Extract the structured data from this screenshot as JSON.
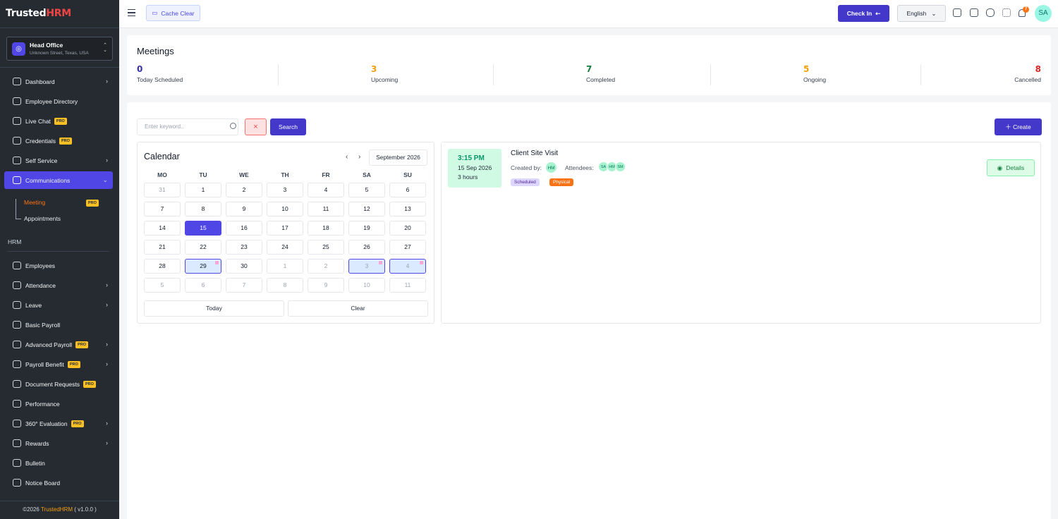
{
  "sidebar": {
    "logo_prefix": "Trusted",
    "logo_suffix": "HRM",
    "office": {
      "name": "Head Office",
      "address": "Unknown Street, Texas, USA"
    },
    "items": [
      {
        "label": "Dashboard",
        "icon": "dashboard-icon"
      },
      {
        "label": "Employee Directory",
        "icon": "directory-icon"
      },
      {
        "label": "Live Chat",
        "icon": "chat-icon",
        "badge": "PRO"
      },
      {
        "label": "Credentials",
        "icon": "key-icon",
        "badge": "PRO"
      },
      {
        "label": "Self Service",
        "icon": "self-service-icon"
      },
      {
        "label": "Communications",
        "icon": "users-icon"
      }
    ],
    "sub_items": [
      {
        "label": "Meeting",
        "badge": "PRO"
      },
      {
        "label": "Appointments"
      }
    ],
    "section": "HRM",
    "hrm_items": [
      {
        "label": "Employees"
      },
      {
        "label": "Attendance"
      },
      {
        "label": "Leave"
      },
      {
        "label": "Basic Payroll"
      },
      {
        "label": "Advanced Payroll",
        "badge": "PRO"
      },
      {
        "label": "Payroll Benefit",
        "badge": "PRO"
      },
      {
        "label": "Document Requests",
        "badge": "PRO"
      },
      {
        "label": "Performance"
      },
      {
        "label": "360° Evaluation",
        "badge": "PRO"
      },
      {
        "label": "Rewards"
      },
      {
        "label": "Bulletin"
      },
      {
        "label": "Notice Board"
      }
    ],
    "footer_prefix": "©2026 ",
    "footer_brand": "TrustedHRM",
    "footer_version": " ( v1.0.0 )"
  },
  "topbar": {
    "cache_label": "Cache Clear",
    "checkin_label": "Check In",
    "language": "English",
    "notification_count": "7",
    "avatar_initials": "SA",
    "icons": [
      "add-icon",
      "task-icon",
      "message-icon",
      "apps-icon",
      "bell-icon"
    ]
  },
  "stats": {
    "title": "Meetings",
    "items": [
      {
        "value": "0",
        "label": "Today Scheduled",
        "color": "#3730a3"
      },
      {
        "value": "3",
        "label": "Upcoming",
        "color": "#f59e0b"
      },
      {
        "value": "7",
        "label": "Completed",
        "color": "#15803d"
      },
      {
        "value": "5",
        "label": "Ongoing",
        "color": "#f59e0b"
      },
      {
        "value": "8",
        "label": "Cancelled",
        "color": "#dc2626"
      }
    ]
  },
  "filter": {
    "placeholder": "Enter keyword..",
    "clear_symbol": "×",
    "search_label": "Search",
    "create_label": "Create"
  },
  "calendar": {
    "title": "Calendar",
    "month_label": "September 2026",
    "prev_symbol": "‹",
    "next_symbol": "›",
    "weekdays": [
      "MO",
      "TU",
      "WE",
      "TH",
      "FR",
      "SA",
      "SU"
    ],
    "weeks": [
      [
        "31",
        "1",
        "2",
        "3",
        "4",
        "5",
        "6"
      ],
      [
        "7",
        "8",
        "9",
        "10",
        "11",
        "12",
        "13"
      ],
      [
        "14",
        "15",
        "16",
        "17",
        "18",
        "19",
        "20"
      ],
      [
        "21",
        "22",
        "23",
        "24",
        "25",
        "26",
        "27"
      ],
      [
        "28",
        "29",
        "30",
        "1",
        "2",
        "3",
        "4"
      ],
      [
        "5",
        "6",
        "7",
        "8",
        "9",
        "10",
        "11"
      ]
    ],
    "today_label": "Today",
    "clear_label": "Clear"
  },
  "meeting": {
    "time": "3:15 PM",
    "date": "15 Sep 2026",
    "duration": "3 hours",
    "title": "Client Site Visit",
    "created_by_label": "Created by:",
    "creator_initials": "HM",
    "attendees_label": "Attendees:",
    "attendees": [
      "SA",
      "HM",
      "SM"
    ],
    "status_tag": "Scheduled",
    "type_tag": "Physical",
    "details_label": "Details"
  }
}
